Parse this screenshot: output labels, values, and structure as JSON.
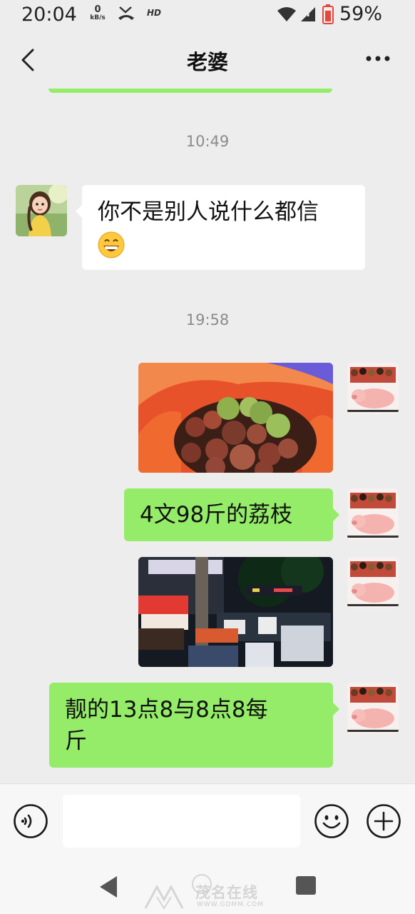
{
  "status_bar": {
    "time": "20:04",
    "net_speed_value": "0",
    "net_speed_unit": "kB/s",
    "hd_label": "HD",
    "battery_percent": "59%"
  },
  "header": {
    "title": "老婆"
  },
  "messages": [
    {
      "type": "timestamp",
      "text": "10:49"
    },
    {
      "type": "text",
      "side": "left",
      "text": "你不是别人说什么都信",
      "emoji": "😄"
    },
    {
      "type": "timestamp",
      "text": "19:58"
    },
    {
      "type": "image",
      "side": "right",
      "description_icon": "lychee-photo"
    },
    {
      "type": "text",
      "side": "right",
      "text": "4文98斤的荔枝"
    },
    {
      "type": "image",
      "side": "right",
      "description_icon": "night-market-photo"
    },
    {
      "type": "text",
      "side": "right",
      "text_line1": "靓的13点8与8点8每",
      "text_line2": "斤"
    }
  ],
  "input_bar": {
    "placeholder": ""
  },
  "watermark": {
    "brand": "茂名在线",
    "url": "WWW.GDMM.COM"
  },
  "colors": {
    "background": "#ededed",
    "bubble_sent": "#95ec69",
    "bubble_received": "#ffffff",
    "battery_red": "#e8453c"
  }
}
